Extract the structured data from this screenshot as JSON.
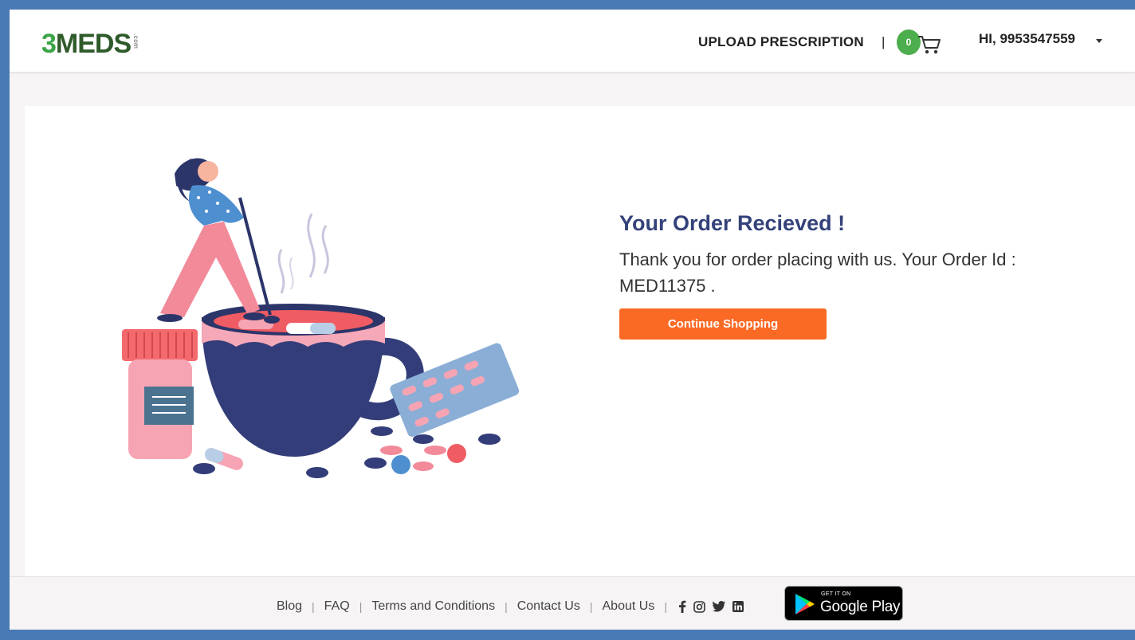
{
  "header": {
    "logo_main": "3",
    "logo_rest": "MEDS",
    "logo_suffix": ".com",
    "upload_prescription": "UPLOAD PRESCRIPTION",
    "separator": "|",
    "cart_count": "0",
    "user_greeting": "HI, 9953547559"
  },
  "main": {
    "title": "Your Order Recieved !",
    "message_line1": "Thank you for order placing with us. Your Order Id :",
    "message_line2": "MED11375 .",
    "continue_button": "Continue Shopping"
  },
  "footer": {
    "links": [
      "Blog",
      "FAQ",
      "Terms and Conditions",
      "Contact Us",
      "About Us"
    ],
    "separator": "|",
    "social_icons": [
      "facebook-icon",
      "instagram-icon",
      "twitter-icon",
      "linkedin-icon"
    ],
    "google_play_small": "GET IT ON",
    "google_play_big": "Google Play"
  },
  "colors": {
    "frame_border": "#4a7ab5",
    "logo_green": "#3aa446",
    "badge_green": "#4cae4c",
    "title_navy": "#34427a",
    "cta_orange": "#fb6a25"
  }
}
